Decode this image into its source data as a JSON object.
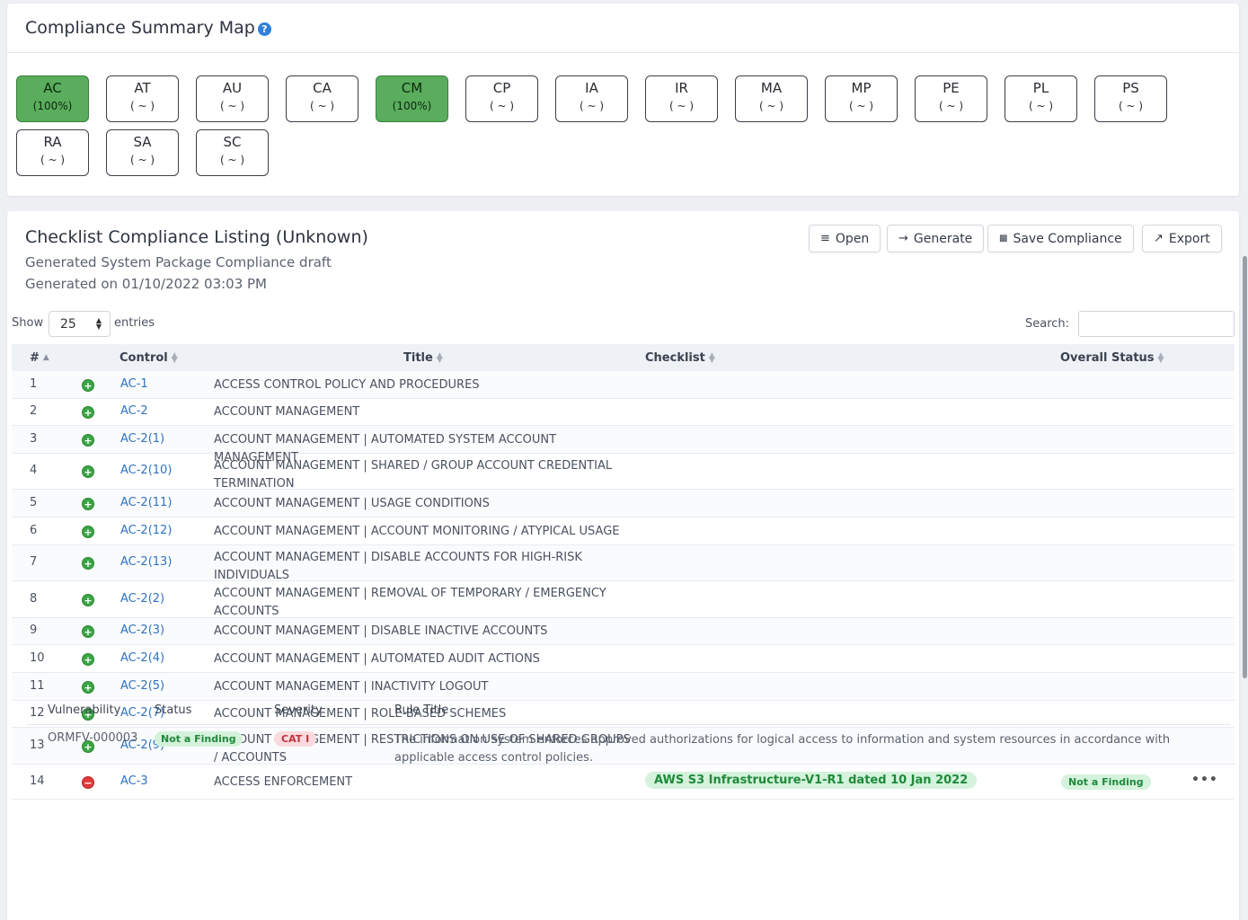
{
  "map": {
    "title": "Compliance Summary Map",
    "help_icon": "?",
    "families": [
      {
        "code": "AC",
        "pct": "(100%)",
        "full": true
      },
      {
        "code": "AT",
        "pct": "( ~ )",
        "full": false
      },
      {
        "code": "AU",
        "pct": "( ~ )",
        "full": false
      },
      {
        "code": "CA",
        "pct": "( ~ )",
        "full": false
      },
      {
        "code": "CM",
        "pct": "(100%)",
        "full": true
      },
      {
        "code": "CP",
        "pct": "( ~ )",
        "full": false
      },
      {
        "code": "IA",
        "pct": "( ~ )",
        "full": false
      },
      {
        "code": "IR",
        "pct": "( ~ )",
        "full": false
      },
      {
        "code": "MA",
        "pct": "( ~ )",
        "full": false
      },
      {
        "code": "MP",
        "pct": "( ~ )",
        "full": false
      },
      {
        "code": "PE",
        "pct": "( ~ )",
        "full": false
      },
      {
        "code": "PL",
        "pct": "( ~ )",
        "full": false
      },
      {
        "code": "PS",
        "pct": "( ~ )",
        "full": false
      },
      {
        "code": "RA",
        "pct": "( ~ )",
        "full": false
      },
      {
        "code": "SA",
        "pct": "( ~ )",
        "full": false
      },
      {
        "code": "SC",
        "pct": "( ~ )",
        "full": false
      }
    ]
  },
  "listing": {
    "title": "Checklist Compliance Listing (Unknown)",
    "subtitle1": "Generated System Package Compliance draft",
    "subtitle2": "Generated on 01/10/2022 03:03 PM",
    "buttons": {
      "open": "Open",
      "generate": "Generate",
      "save": "Save Compliance",
      "export": "Export"
    },
    "show_label": "Show",
    "entries_value": "25",
    "entries_label": "entries",
    "search_label": "Search:",
    "columns": {
      "num": "#",
      "control": "Control",
      "title": "Title",
      "checklist": "Checklist",
      "status": "Overall Status"
    },
    "rows": [
      {
        "num": "1",
        "control": "AC-1",
        "title": "ACCESS CONTROL POLICY AND PROCEDURES"
      },
      {
        "num": "2",
        "control": "AC-2",
        "title": "ACCOUNT MANAGEMENT"
      },
      {
        "num": "3",
        "control": "AC-2(1)",
        "title": "ACCOUNT MANAGEMENT | AUTOMATED SYSTEM ACCOUNT MANAGEMENT"
      },
      {
        "num": "4",
        "control": "AC-2(10)",
        "title": "ACCOUNT MANAGEMENT | SHARED / GROUP ACCOUNT CREDENTIAL TERMINATION"
      },
      {
        "num": "5",
        "control": "AC-2(11)",
        "title": "ACCOUNT MANAGEMENT | USAGE CONDITIONS"
      },
      {
        "num": "6",
        "control": "AC-2(12)",
        "title": "ACCOUNT MANAGEMENT | ACCOUNT MONITORING / ATYPICAL USAGE"
      },
      {
        "num": "7",
        "control": "AC-2(13)",
        "title": "ACCOUNT MANAGEMENT | DISABLE ACCOUNTS FOR HIGH-RISK INDIVIDUALS"
      },
      {
        "num": "8",
        "control": "AC-2(2)",
        "title": "ACCOUNT MANAGEMENT | REMOVAL OF TEMPORARY / EMERGENCY ACCOUNTS"
      },
      {
        "num": "9",
        "control": "AC-2(3)",
        "title": "ACCOUNT MANAGEMENT | DISABLE INACTIVE ACCOUNTS"
      },
      {
        "num": "10",
        "control": "AC-2(4)",
        "title": "ACCOUNT MANAGEMENT | AUTOMATED AUDIT ACTIONS"
      },
      {
        "num": "11",
        "control": "AC-2(5)",
        "title": "ACCOUNT MANAGEMENT | INACTIVITY LOGOUT"
      },
      {
        "num": "12",
        "control": "AC-2(7)",
        "title": "ACCOUNT MANAGEMENT | ROLE-BASED SCHEMES"
      },
      {
        "num": "13",
        "control": "AC-2(9)",
        "title": "ACCOUNT MANAGEMENT | RESTRICTIONS ON USE OF SHARED GROUPS / ACCOUNTS"
      },
      {
        "num": "14",
        "control": "AC-3",
        "title": "ACCESS ENFORCEMENT",
        "checklist": "AWS S3 Infrastructure-V1-R1 dated 10 Jan 2022",
        "status": "Not a Finding",
        "expanded": true
      }
    ],
    "detail": {
      "columns": {
        "vuln": "Vulnerability",
        "status": "Status",
        "severity": "Severity",
        "rule": "Rule Title"
      },
      "row": {
        "vuln": "ORMFV-000003",
        "status": "Not a Finding",
        "severity": "CAT I",
        "rule": "The information system enforces approved authorizations for logical access to information and system resources in accordance with applicable access control policies."
      }
    }
  }
}
